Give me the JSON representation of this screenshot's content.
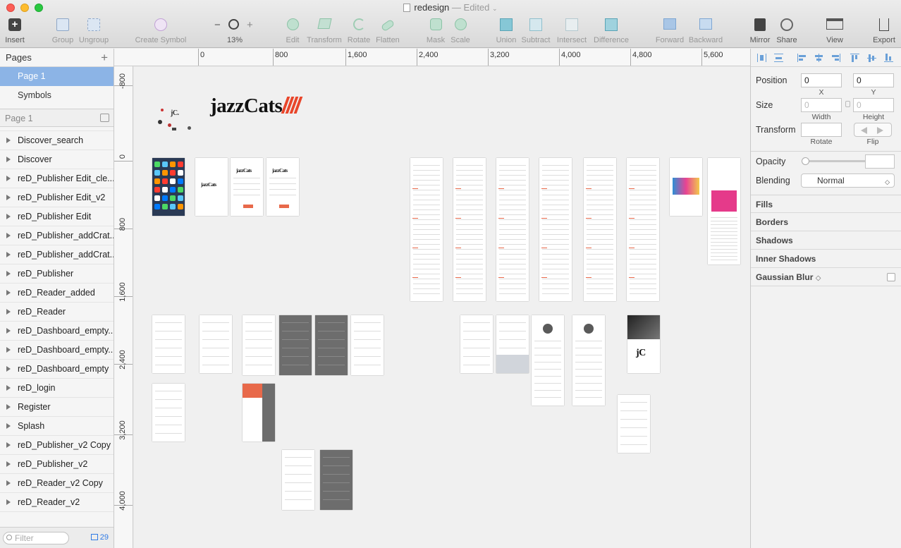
{
  "window": {
    "title": "redesign",
    "edited": "— Edited"
  },
  "toolbar": {
    "insert": "Insert",
    "group": "Group",
    "ungroup": "Ungroup",
    "create_symbol": "Create Symbol",
    "zoom_minus": "−",
    "zoom_plus": "+",
    "zoom_level": "13%",
    "edit": "Edit",
    "transform": "Transform",
    "rotate": "Rotate",
    "flatten": "Flatten",
    "mask": "Mask",
    "scale": "Scale",
    "union": "Union",
    "subtract": "Subtract",
    "intersect": "Intersect",
    "difference": "Difference",
    "forward": "Forward",
    "backward": "Backward",
    "mirror": "Mirror",
    "share": "Share",
    "view": "View",
    "export": "Export"
  },
  "sidebar": {
    "pages_title": "Pages",
    "add_page": "+",
    "pages": [
      "Page 1",
      "Symbols"
    ],
    "current_page": "Page 1",
    "layers": [
      "Discover_search",
      "Discover",
      "reD_Publisher Edit_cle...",
      "reD_Publisher Edit_v2",
      "reD_Publisher Edit",
      "reD_Publisher_addCrat...",
      "reD_Publisher_addCrat...",
      "reD_Publisher",
      "reD_Reader_added",
      "reD_Reader",
      "reD_Dashboard_empty...",
      "reD_Dashboard_empty...",
      "reD_Dashboard_empty",
      "reD_login",
      "Register",
      "Splash",
      "reD_Publisher_v2 Copy",
      "reD_Publisher_v2",
      "reD_Reader_v2 Copy",
      "reD_Reader_v2"
    ],
    "filter_placeholder": "Filter",
    "artboard_count": "29"
  },
  "rulers": {
    "top": [
      "0",
      "800",
      "1,600",
      "2,400",
      "3,200",
      "4,000",
      "4,800",
      "5,600"
    ],
    "left": [
      "-800",
      "0",
      "800",
      "1,600",
      "2,400",
      "3,200",
      "4,000"
    ]
  },
  "canvas": {
    "logo_text": "jazzCats",
    "small_logo": "jC.",
    "board_logo": "jazzCats",
    "board_logo_short": "jC"
  },
  "inspector": {
    "position_label": "Position",
    "x_value": "0",
    "y_value": "0",
    "x_label": "X",
    "y_label": "Y",
    "size_label": "Size",
    "width_value": "0",
    "height_value": "0",
    "width_label": "Width",
    "height_label": "Height",
    "transform_label": "Transform",
    "rotate_label": "Rotate",
    "flip_label": "Flip",
    "opacity_label": "Opacity",
    "blending_label": "Blending",
    "blending_value": "Normal",
    "fills": "Fills",
    "borders": "Borders",
    "shadows": "Shadows",
    "inner_shadows": "Inner Shadows",
    "gaussian_blur": "Gaussian Blur"
  },
  "colors": {
    "accent": "#e8452a",
    "selection": "#8cb4e6",
    "link_blue": "#2f7ae5"
  }
}
